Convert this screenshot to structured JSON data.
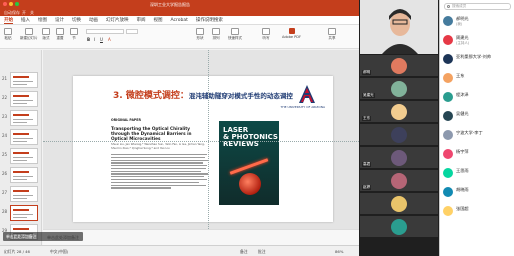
{
  "window": {
    "title": "深圳工业大学报告报告",
    "quick_items": [
      "自动保存",
      "开",
      "关"
    ]
  },
  "ribbon": {
    "tabs": [
      "开始",
      "插入",
      "绘图",
      "设计",
      "切换",
      "动画",
      "幻灯片放映",
      "审阅",
      "视图",
      "Acrobat",
      "操作说明搜索"
    ],
    "active_tab": "开始",
    "buttons": [
      "粘贴",
      "新建幻灯片",
      "版式",
      "重置",
      "节",
      "形状",
      "排列",
      "快速样式",
      "听写",
      "Adobe PDF",
      "共享"
    ],
    "font_name": "",
    "font_size": ""
  },
  "thumbnails": [
    {
      "num": "21"
    },
    {
      "num": "22"
    },
    {
      "num": "23"
    },
    {
      "num": "24"
    },
    {
      "num": "25"
    },
    {
      "num": "26"
    },
    {
      "num": "27"
    },
    {
      "num": "28"
    },
    {
      "num": "29"
    },
    {
      "num": "30"
    }
  ],
  "slide": {
    "title_main": "3. 微腔模式调控：",
    "title_sub": "混沌辅助隧穿对模式手性的动态调控",
    "logo_caption": "THE UNIVERSITY OF ARIZONA",
    "paper": {
      "header": "ORIGINAL PAPER",
      "title": "Transporting the Optical Chirality through the Dynamical Barriers in Optical Microcavities",
      "authors": "Shuai Liu, Jan Wiersig,* Wenzhao Sun, Yalin Fan, Li Ge, Jinhan Yang, Shumin Xiao,* Qinghai Song,* and Yao Liu"
    },
    "cover": {
      "journal_line1": "LASER",
      "journal_line2": "& PHOTONICS",
      "journal_line3": "REVIEWS"
    }
  },
  "notes_placeholder": "单击此处添加备注",
  "status": {
    "slide_of": "幻灯片 28 / 46",
    "language": "中文(中国)",
    "notes": "备注",
    "comments": "批注",
    "zoom": "86%"
  },
  "caption_overlay": "单击此处添加备注",
  "tiles": [
    {
      "name": "",
      "type": "video"
    },
    {
      "name": "郝明",
      "color": "#e07a5f"
    },
    {
      "name": "吴建光",
      "color": "#81b29a"
    },
    {
      "name": "王东",
      "color": "#f2cc8f"
    },
    {
      "name": "",
      "color": "#3d405b"
    },
    {
      "name": "高君",
      "color": "#6d597a"
    },
    {
      "name": "赵婷",
      "color": "#b56576"
    },
    {
      "name": "",
      "color": "#e9c46a"
    },
    {
      "name": "",
      "color": "#2a9d8f"
    }
  ],
  "roster": {
    "search_placeholder": "搜索成员",
    "members": [
      {
        "name": "郝明光",
        "role": "(我)",
        "color": "#457b9d"
      },
      {
        "name": "周建光",
        "role": "(主持人)",
        "color": "#e63946"
      },
      {
        "name": "亚利桑那大学-刘帅",
        "role": "",
        "color": "#1d3557"
      },
      {
        "name": "王东",
        "role": "",
        "color": "#f4a261"
      },
      {
        "name": "程沐泽",
        "role": "",
        "color": "#2a9d8f"
      },
      {
        "name": "吴健光",
        "role": "",
        "color": "#264653"
      },
      {
        "name": "宁波大学-李丁",
        "role": "",
        "color": "#8d99ae"
      },
      {
        "name": "杨宇萍",
        "role": "",
        "color": "#ef476f"
      },
      {
        "name": "王思雨",
        "role": "",
        "color": "#06d6a0"
      },
      {
        "name": "胡晓雨",
        "role": "",
        "color": "#118ab2"
      },
      {
        "name": "张国超",
        "role": "",
        "color": "#ffd166"
      }
    ]
  }
}
